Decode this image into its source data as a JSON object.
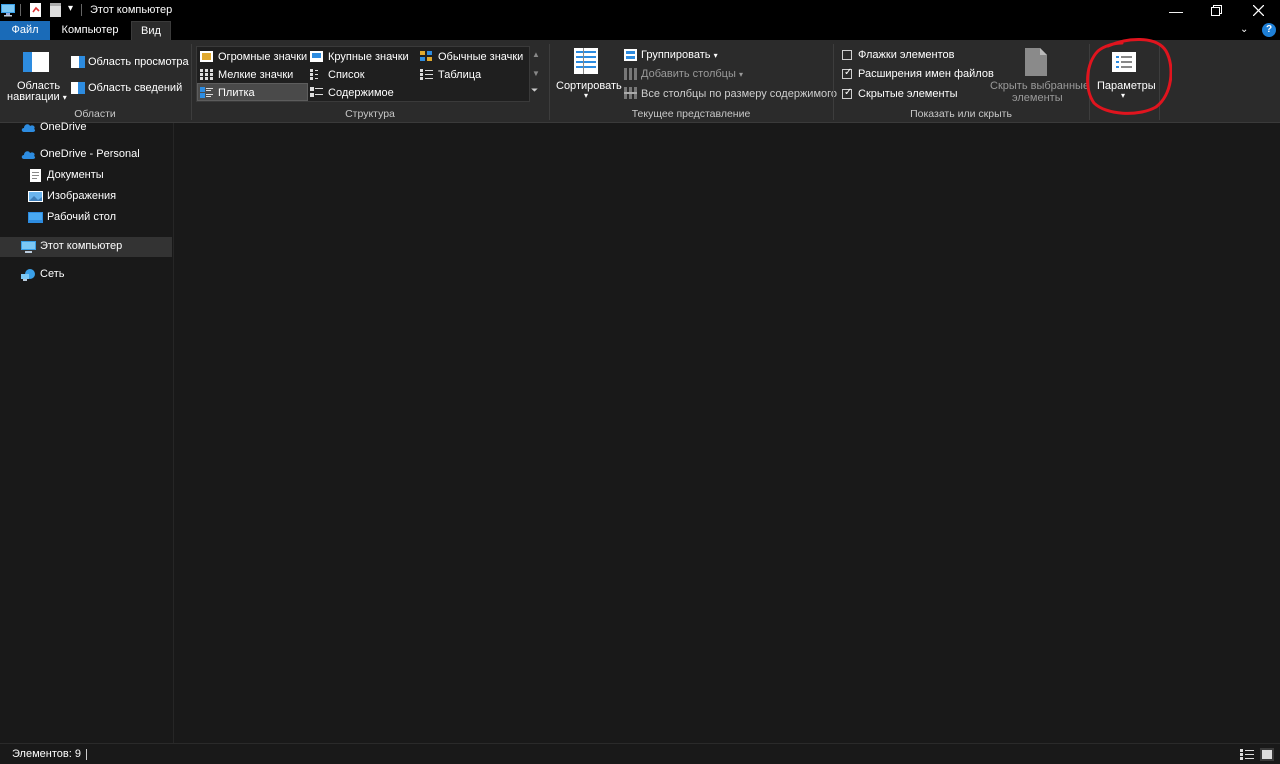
{
  "window": {
    "title": "Этот компьютер"
  },
  "ribbon_tabs": [
    "Файл",
    "Компьютер",
    "Вид"
  ],
  "groups": {
    "areas": {
      "label": "Области",
      "nav_pane": [
        "Область",
        "навигации"
      ],
      "preview_pane": "Область просмотра",
      "details_pane": "Область сведений"
    },
    "layout": {
      "label": "Структура",
      "options": [
        [
          "Огромные значки",
          "Крупные значки",
          "Обычные значки"
        ],
        [
          "Мелкие значки",
          "Список",
          "Таблица"
        ],
        [
          "Плитка",
          "Содержимое",
          ""
        ]
      ],
      "selected": "Плитка"
    },
    "current_view": {
      "label": "Текущее представление",
      "sort": "Сортировать",
      "group_by": "Группировать",
      "add_columns": "Добавить столбцы",
      "size_all_columns": "Все столбцы по размеру содержимого"
    },
    "show_hide": {
      "label": "Показать или скрыть",
      "item_checkboxes": {
        "label": "Флажки элементов",
        "checked": false
      },
      "file_extensions": {
        "label": "Расширения имен файлов",
        "checked": true
      },
      "hidden_items": {
        "label": "Скрытые элементы",
        "checked": true
      },
      "hide_selected": [
        "Скрыть выбранные",
        "элементы"
      ]
    },
    "options": {
      "label": "Параметры"
    }
  },
  "nav": {
    "items": [
      {
        "label": "OneDrive",
        "icon": "cloud-icon"
      },
      {
        "label": "OneDrive - Personal",
        "icon": "cloud-icon"
      },
      {
        "label": "Документы",
        "icon": "document-icon"
      },
      {
        "label": "Изображения",
        "icon": "image-icon"
      },
      {
        "label": "Рабочий стол",
        "icon": "desktop-icon"
      },
      {
        "label": "Этот компьютер",
        "icon": "computer-icon",
        "selected": true
      },
      {
        "label": "Сеть",
        "icon": "network-icon"
      }
    ]
  },
  "status": {
    "items_count": "Элементов: 9"
  },
  "colors": {
    "accent": "#1a6bb8",
    "annotation": "#e0141e",
    "background": "#191919",
    "ribbon": "#2b2b2b"
  }
}
